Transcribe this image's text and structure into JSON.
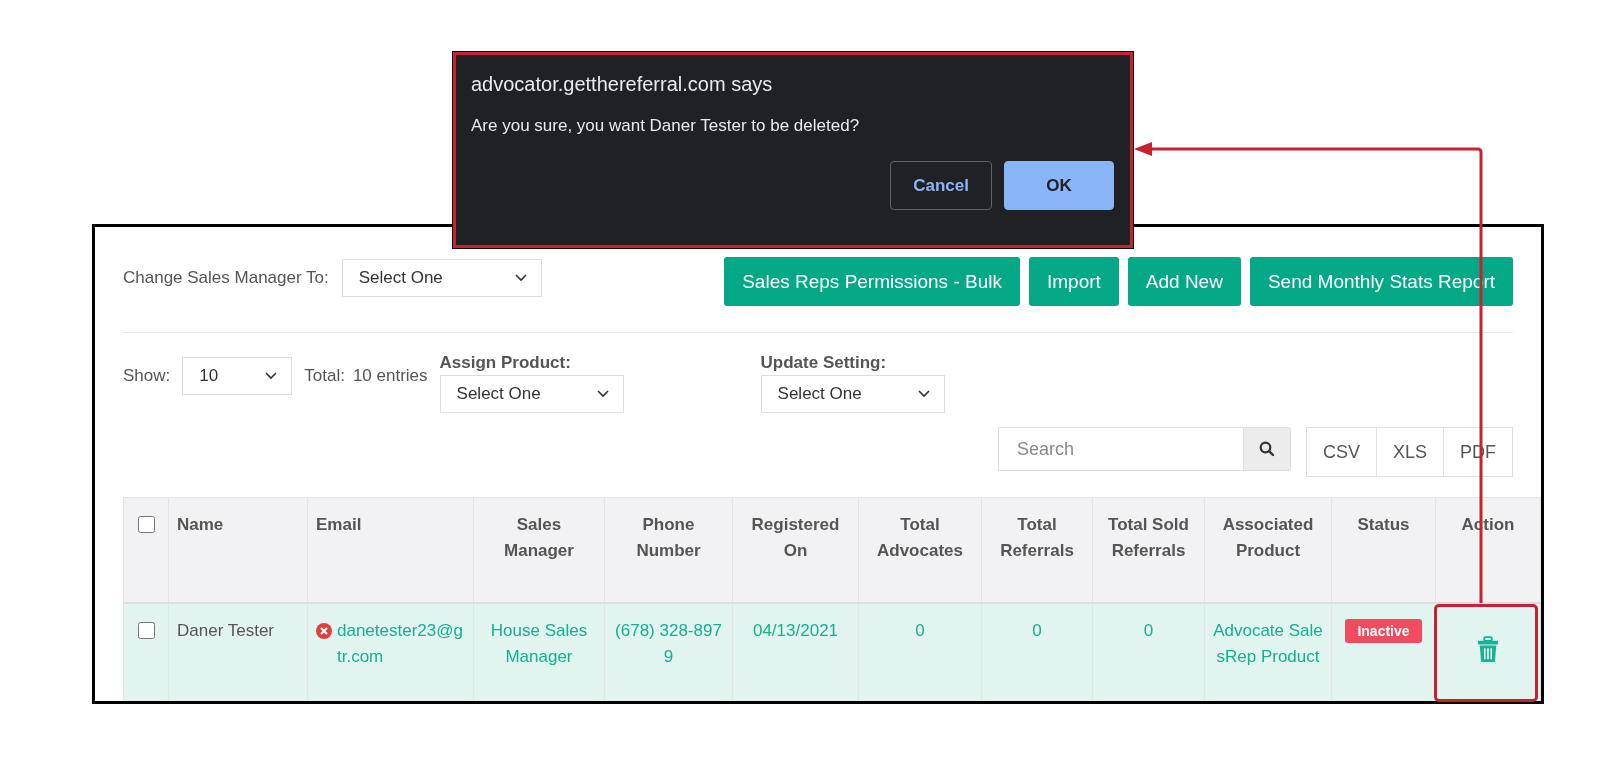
{
  "dialog": {
    "title": "advocator.getthereferral.com says",
    "message": "Are you sure, you want Daner Tester to be deleted?",
    "buttons": [
      {
        "label": "Cancel",
        "primary": false
      },
      {
        "label": "OK",
        "primary": true
      }
    ]
  },
  "toolbar": {
    "label": "Change Sales Manager To:",
    "select": "Select One",
    "buttons": [
      "Sales Reps Permissions - Bulk",
      "Import",
      "Add New",
      "Send Monthly Stats Report"
    ]
  },
  "filters": {
    "show_label": "Show:",
    "show_value": "10",
    "total_label": "Total:",
    "total_value": "10 entries",
    "assign_label": "Assign Product:",
    "assign_value": "Select One",
    "update_label": "Update Setting:",
    "update_value": "Select One"
  },
  "search": {
    "placeholder": "Search"
  },
  "exports": [
    "CSV",
    "XLS",
    "PDF"
  ],
  "table": {
    "select_all_checked": false,
    "columns": [
      "Name",
      "Email",
      "Sales Manager",
      "Phone Number",
      "Registered On",
      "Total Advocates",
      "Total Referrals",
      "Total Sold Referrals",
      "Associated Product",
      "Status",
      "Action"
    ],
    "rows": [
      {
        "checked": false,
        "highlighted": true,
        "name": "Daner Tester",
        "email_error": true,
        "email": "danetester23@gtr.com",
        "sales_manager": "House Sales Manager",
        "phone": "(678) 328-8979",
        "registered": "04/13/2021",
        "advocates": "0",
        "referrals": "0",
        "sold": "0",
        "product": "Advocate SalesRep Product",
        "status": {
          "label": "Inactive",
          "kind": "inactive"
        }
      }
    ]
  }
}
